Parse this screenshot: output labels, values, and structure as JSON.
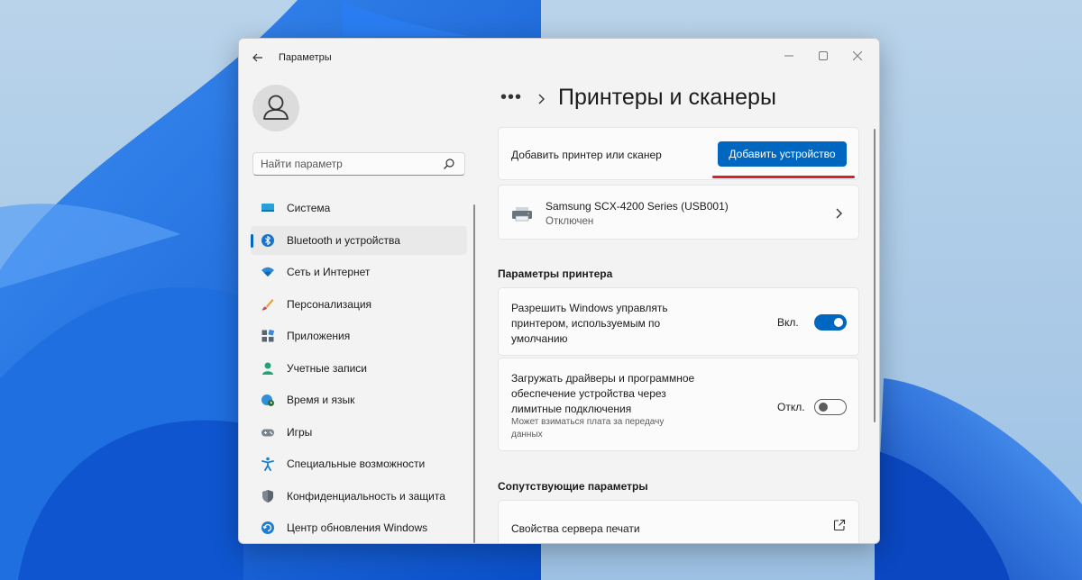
{
  "window": {
    "app_title": "Параметры",
    "back_icon": "arrow-left-icon",
    "controls": [
      "minimize-icon",
      "maximize-icon",
      "close-icon"
    ]
  },
  "search": {
    "placeholder": "Найти параметр",
    "icon": "search-icon"
  },
  "sidebar": {
    "items": [
      {
        "label": "Система",
        "icon": "monitor-icon",
        "active": false
      },
      {
        "label": "Bluetooth и устройства",
        "icon": "bluetooth-icon",
        "active": true
      },
      {
        "label": "Сеть и Интернет",
        "icon": "wifi-icon",
        "active": false
      },
      {
        "label": "Персонализация",
        "icon": "brush-icon",
        "active": false
      },
      {
        "label": "Приложения",
        "icon": "apps-icon",
        "active": false
      },
      {
        "label": "Учетные записи",
        "icon": "person-icon",
        "active": false
      },
      {
        "label": "Время и язык",
        "icon": "globe-clock-icon",
        "active": false
      },
      {
        "label": "Игры",
        "icon": "gamepad-icon",
        "active": false
      },
      {
        "label": "Специальные возможности",
        "icon": "accessibility-icon",
        "active": false
      },
      {
        "label": "Конфиденциальность и защита",
        "icon": "shield-icon",
        "active": false
      },
      {
        "label": "Центр обновления Windows",
        "icon": "update-icon",
        "active": false
      }
    ]
  },
  "header": {
    "breadcrumb_dots": "•••",
    "title": "Принтеры и сканеры"
  },
  "add_card": {
    "label": "Добавить принтер или сканер",
    "button": "Добавить устройство"
  },
  "printer": {
    "name": "Samsung SCX-4200 Series (USB001)",
    "status": "Отключен"
  },
  "printer_settings": {
    "heading": "Параметры принтера",
    "manage_default": {
      "lines": [
        "Разрешить Windows управлять",
        "принтером, используемым по",
        "умолчанию"
      ],
      "state": "Вкл.",
      "on": true
    },
    "metered_download": {
      "lines": [
        "Загружать драйверы и программное",
        "обеспечение устройства через",
        "лимитные подключения"
      ],
      "note_lines": [
        "Может взиматься плата за передачу",
        "данных"
      ],
      "state": "Откл.",
      "on": false
    }
  },
  "related": {
    "heading": "Сопутствующие параметры",
    "print_server": "Свойства сервера печати"
  },
  "colors": {
    "accent": "#0067c0",
    "highlight_underline": "#d9202a"
  }
}
